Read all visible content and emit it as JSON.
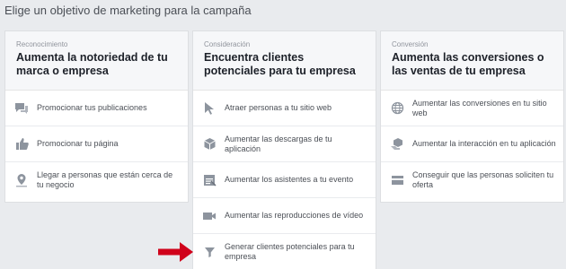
{
  "page": {
    "title": "Elige un objetivo de marketing para la campaña"
  },
  "columns": [
    {
      "kicker": "Reconocimiento",
      "title": "Aumenta la notoriedad de tu marca o empresa",
      "items": [
        {
          "label": "Promocionar tus publicaciones",
          "icon": "speech-bubble-icon"
        },
        {
          "label": "Promocionar tu página",
          "icon": "thumbs-up-icon"
        },
        {
          "label": "Llegar a personas que están cerca de tu negocio",
          "icon": "location-pin-icon"
        }
      ]
    },
    {
      "kicker": "Consideración",
      "title": "Encuentra clientes potenciales para tu empresa",
      "items": [
        {
          "label": "Atraer personas a tu sitio web",
          "icon": "cursor-icon"
        },
        {
          "label": "Aumentar las descargas de tu aplicación",
          "icon": "cube-icon"
        },
        {
          "label": "Aumentar los asistentes a tu evento",
          "icon": "calendar-icon"
        },
        {
          "label": "Aumentar las reproducciones de vídeo",
          "icon": "video-camera-icon"
        },
        {
          "label": "Generar clientes potenciales para tu empresa",
          "icon": "funnel-icon"
        }
      ]
    },
    {
      "kicker": "Conversión",
      "title": "Aumenta las conversiones o las ventas de tu empresa",
      "items": [
        {
          "label": "Aumentar las conversiones en tu sitio web",
          "icon": "globe-icon"
        },
        {
          "label": "Aumentar la interacción en tu aplicación",
          "icon": "cube-hand-icon"
        },
        {
          "label": "Conseguir que las personas soliciten tu oferta",
          "icon": "offer-card-icon"
        }
      ]
    }
  ],
  "colors": {
    "background": "#e9ebee",
    "icon": "#8d949e",
    "arrow": "#d0021b"
  }
}
